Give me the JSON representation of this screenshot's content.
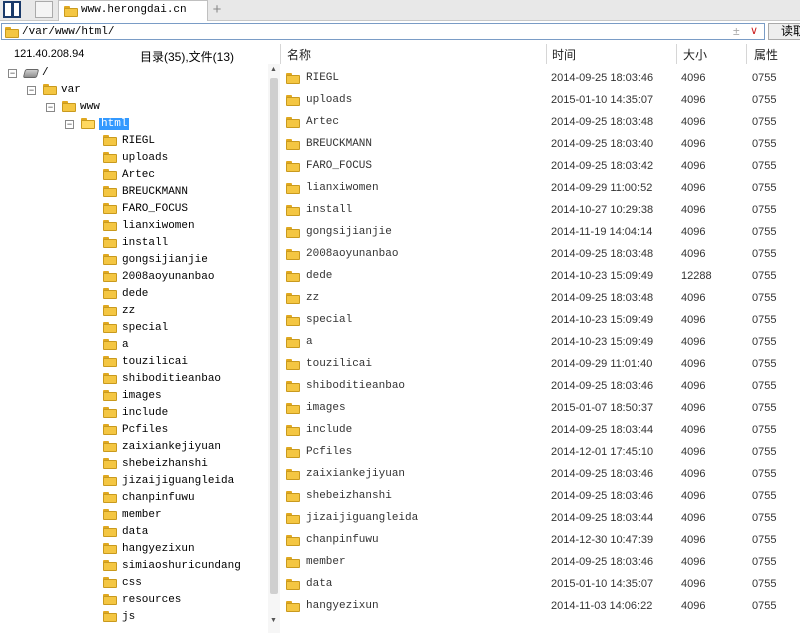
{
  "tab": {
    "title": "www.herongdai.cn",
    "new_tab": "+"
  },
  "pathbar": {
    "path": "/var/www/html/",
    "plusminus": "±",
    "dropdown": "∨",
    "read_label": "读取"
  },
  "status": {
    "ip": "121.40.208.94",
    "counts": "目录(35),文件(13)"
  },
  "columns": {
    "name": "名称",
    "time": "时间",
    "size": "大小",
    "perm": "属性"
  },
  "tree": [
    {
      "label": "/",
      "depth": 0,
      "toggle": "−",
      "icon": "drive-icon"
    },
    {
      "label": "var",
      "depth": 1,
      "toggle": "−",
      "icon": "folder-icon"
    },
    {
      "label": "www",
      "depth": 2,
      "toggle": "−",
      "icon": "folder-icon"
    },
    {
      "label": "html",
      "depth": 3,
      "toggle": "−",
      "icon": "folder-open-icon",
      "selected": true
    },
    {
      "label": "RIEGL",
      "depth": 4,
      "icon": "folder-icon"
    },
    {
      "label": "uploads",
      "depth": 4,
      "icon": "folder-icon"
    },
    {
      "label": "Artec",
      "depth": 4,
      "icon": "folder-icon"
    },
    {
      "label": "BREUCKMANN",
      "depth": 4,
      "icon": "folder-icon"
    },
    {
      "label": "FARO_FOCUS",
      "depth": 4,
      "icon": "folder-icon"
    },
    {
      "label": "lianxiwomen",
      "depth": 4,
      "icon": "folder-icon"
    },
    {
      "label": "install",
      "depth": 4,
      "icon": "folder-icon"
    },
    {
      "label": "gongsijianjie",
      "depth": 4,
      "icon": "folder-icon"
    },
    {
      "label": "2008aoyunanbao",
      "depth": 4,
      "icon": "folder-icon"
    },
    {
      "label": "dede",
      "depth": 4,
      "icon": "folder-icon"
    },
    {
      "label": "zz",
      "depth": 4,
      "icon": "folder-icon"
    },
    {
      "label": "special",
      "depth": 4,
      "icon": "folder-icon"
    },
    {
      "label": "a",
      "depth": 4,
      "icon": "folder-icon"
    },
    {
      "label": "touzilicai",
      "depth": 4,
      "icon": "folder-icon"
    },
    {
      "label": "shiboditieanbao",
      "depth": 4,
      "icon": "folder-icon"
    },
    {
      "label": "images",
      "depth": 4,
      "icon": "folder-icon"
    },
    {
      "label": "include",
      "depth": 4,
      "icon": "folder-icon"
    },
    {
      "label": "Pcfiles",
      "depth": 4,
      "icon": "folder-icon"
    },
    {
      "label": "zaixiankejiyuan",
      "depth": 4,
      "icon": "folder-icon"
    },
    {
      "label": "shebeizhanshi",
      "depth": 4,
      "icon": "folder-icon"
    },
    {
      "label": "jizaijiguangleida",
      "depth": 4,
      "icon": "folder-icon"
    },
    {
      "label": "chanpinfuwu",
      "depth": 4,
      "icon": "folder-icon"
    },
    {
      "label": "member",
      "depth": 4,
      "icon": "folder-icon"
    },
    {
      "label": "data",
      "depth": 4,
      "icon": "folder-icon"
    },
    {
      "label": "hangyezixun",
      "depth": 4,
      "icon": "folder-icon"
    },
    {
      "label": "simiaoshuricundang",
      "depth": 4,
      "icon": "folder-icon"
    },
    {
      "label": "css",
      "depth": 4,
      "icon": "folder-icon"
    },
    {
      "label": "resources",
      "depth": 4,
      "icon": "folder-icon"
    },
    {
      "label": "js",
      "depth": 4,
      "icon": "folder-icon"
    }
  ],
  "files": [
    {
      "name": "RIEGL",
      "time": "2014-09-25 18:03:46",
      "size": "4096",
      "perm": "0755"
    },
    {
      "name": "uploads",
      "time": "2015-01-10 14:35:07",
      "size": "4096",
      "perm": "0755"
    },
    {
      "name": "Artec",
      "time": "2014-09-25 18:03:48",
      "size": "4096",
      "perm": "0755"
    },
    {
      "name": "BREUCKMANN",
      "time": "2014-09-25 18:03:40",
      "size": "4096",
      "perm": "0755"
    },
    {
      "name": "FARO_FOCUS",
      "time": "2014-09-25 18:03:42",
      "size": "4096",
      "perm": "0755"
    },
    {
      "name": "lianxiwomen",
      "time": "2014-09-29 11:00:52",
      "size": "4096",
      "perm": "0755"
    },
    {
      "name": "install",
      "time": "2014-10-27 10:29:38",
      "size": "4096",
      "perm": "0755"
    },
    {
      "name": "gongsijianjie",
      "time": "2014-11-19 14:04:14",
      "size": "4096",
      "perm": "0755"
    },
    {
      "name": "2008aoyunanbao",
      "time": "2014-09-25 18:03:48",
      "size": "4096",
      "perm": "0755"
    },
    {
      "name": "dede",
      "time": "2014-10-23 15:09:49",
      "size": "12288",
      "perm": "0755"
    },
    {
      "name": "zz",
      "time": "2014-09-25 18:03:48",
      "size": "4096",
      "perm": "0755"
    },
    {
      "name": "special",
      "time": "2014-10-23 15:09:49",
      "size": "4096",
      "perm": "0755"
    },
    {
      "name": "a",
      "time": "2014-10-23 15:09:49",
      "size": "4096",
      "perm": "0755"
    },
    {
      "name": "touzilicai",
      "time": "2014-09-29 11:01:40",
      "size": "4096",
      "perm": "0755"
    },
    {
      "name": "shiboditieanbao",
      "time": "2014-09-25 18:03:46",
      "size": "4096",
      "perm": "0755"
    },
    {
      "name": "images",
      "time": "2015-01-07 18:50:37",
      "size": "4096",
      "perm": "0755"
    },
    {
      "name": "include",
      "time": "2014-09-25 18:03:44",
      "size": "4096",
      "perm": "0755"
    },
    {
      "name": "Pcfiles",
      "time": "2014-12-01 17:45:10",
      "size": "4096",
      "perm": "0755"
    },
    {
      "name": "zaixiankejiyuan",
      "time": "2014-09-25 18:03:46",
      "size": "4096",
      "perm": "0755"
    },
    {
      "name": "shebeizhanshi",
      "time": "2014-09-25 18:03:46",
      "size": "4096",
      "perm": "0755"
    },
    {
      "name": "jizaijiguangleida",
      "time": "2014-09-25 18:03:44",
      "size": "4096",
      "perm": "0755"
    },
    {
      "name": "chanpinfuwu",
      "time": "2014-12-30 10:47:39",
      "size": "4096",
      "perm": "0755"
    },
    {
      "name": "member",
      "time": "2014-09-25 18:03:46",
      "size": "4096",
      "perm": "0755"
    },
    {
      "name": "data",
      "time": "2015-01-10 14:35:07",
      "size": "4096",
      "perm": "0755"
    },
    {
      "name": "hangyezixun",
      "time": "2014-11-03 14:06:22",
      "size": "4096",
      "perm": "0755"
    }
  ]
}
